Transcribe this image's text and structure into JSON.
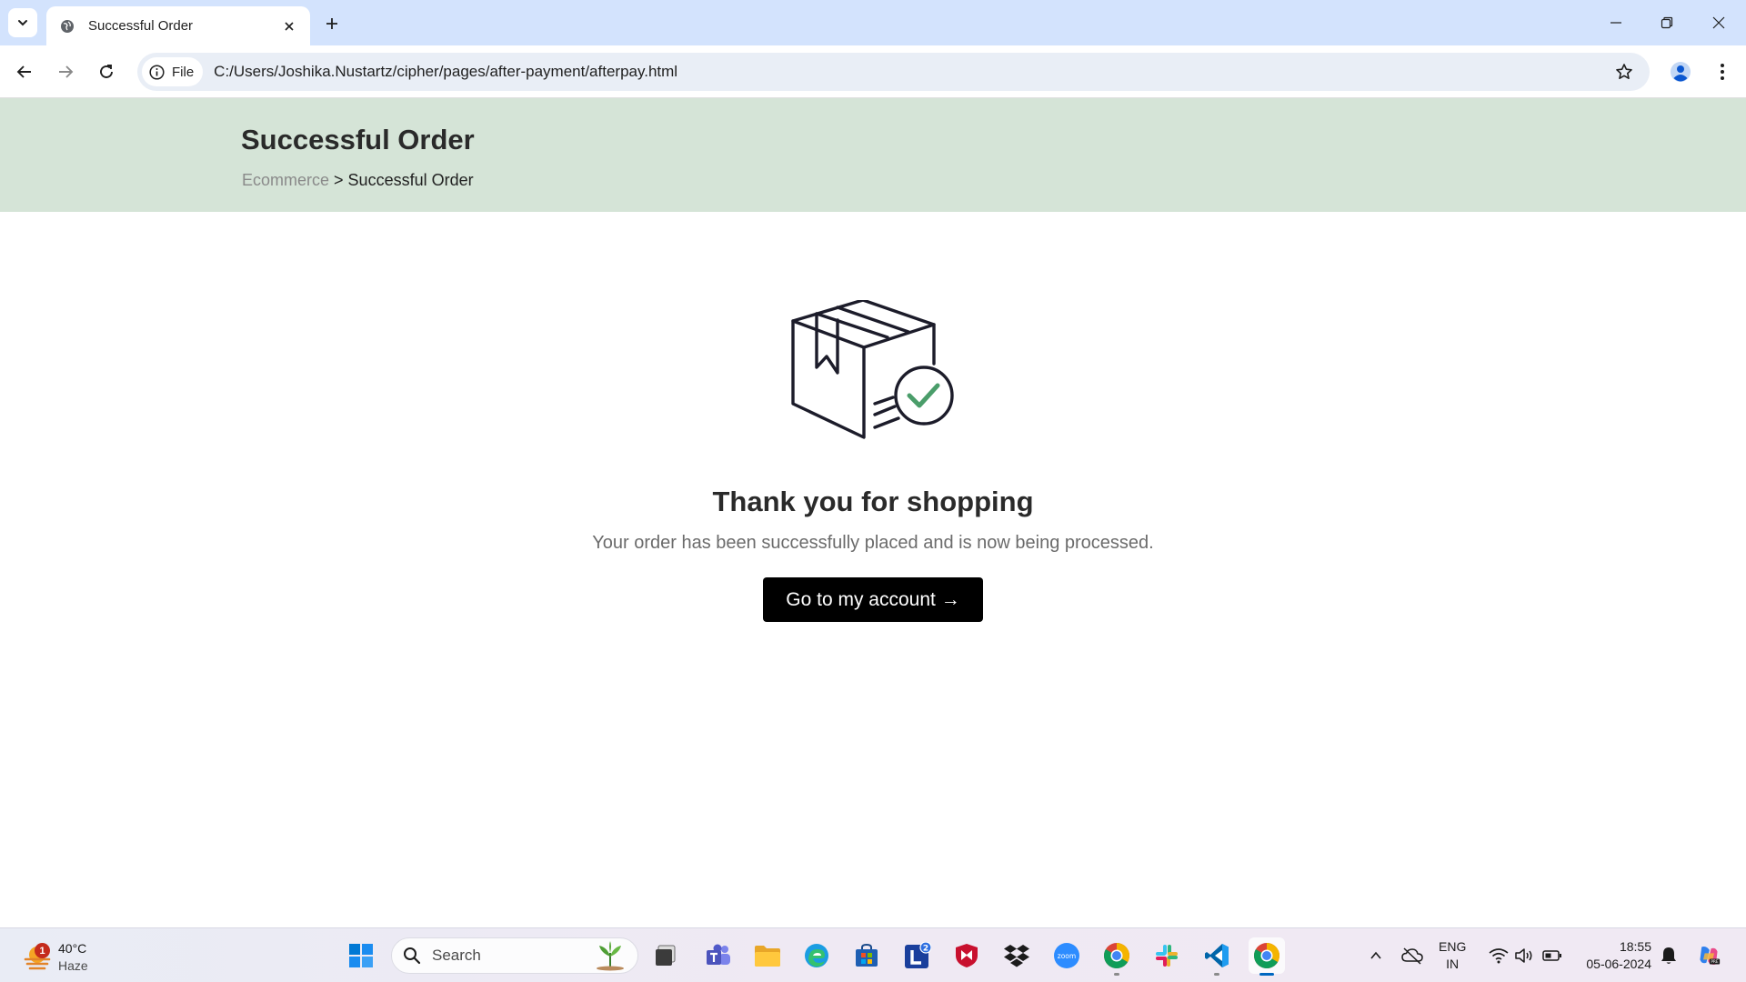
{
  "browser": {
    "tab_title": "Successful Order",
    "site_chip_label": "File",
    "url": "C:/Users/Joshika.Nustartz/cipher/pages/after-payment/afterpay.html"
  },
  "page": {
    "banner_title": "Successful Order",
    "breadcrumb": {
      "link": "Ecommerce",
      "separator": ">",
      "current": "Successful Order"
    },
    "hero_icon": "package-check-icon",
    "thank_title": "Thank you for shopping",
    "thank_subtitle": "Your order has been successfully placed and is now being processed.",
    "cta_label": "Go to my account →"
  },
  "taskbar": {
    "weather": {
      "temp": "40°C",
      "desc": "Haze",
      "badge": "1"
    },
    "search_label": "Search",
    "apps": [
      "windows-start-icon",
      "file-stack-icon",
      "teams-icon",
      "file-explorer-icon",
      "edge-icon",
      "store-icon",
      "l-app-icon",
      "mcafee-icon",
      "dropbox-icon",
      "zoom-icon",
      "chrome-icon",
      "slack-icon",
      "vscode-icon",
      "chrome-icon"
    ],
    "l_app_badge": "2",
    "zoom_label": "zoom",
    "language": {
      "line1": "ENG",
      "line2": "IN"
    },
    "clock": {
      "time": "18:55",
      "date": "05-06-2024"
    }
  },
  "colors": {
    "tabstrip": "#d3e3fd",
    "banner": "#d5e4d7",
    "cta_bg": "#000000",
    "check_green": "#4a9d6a"
  }
}
